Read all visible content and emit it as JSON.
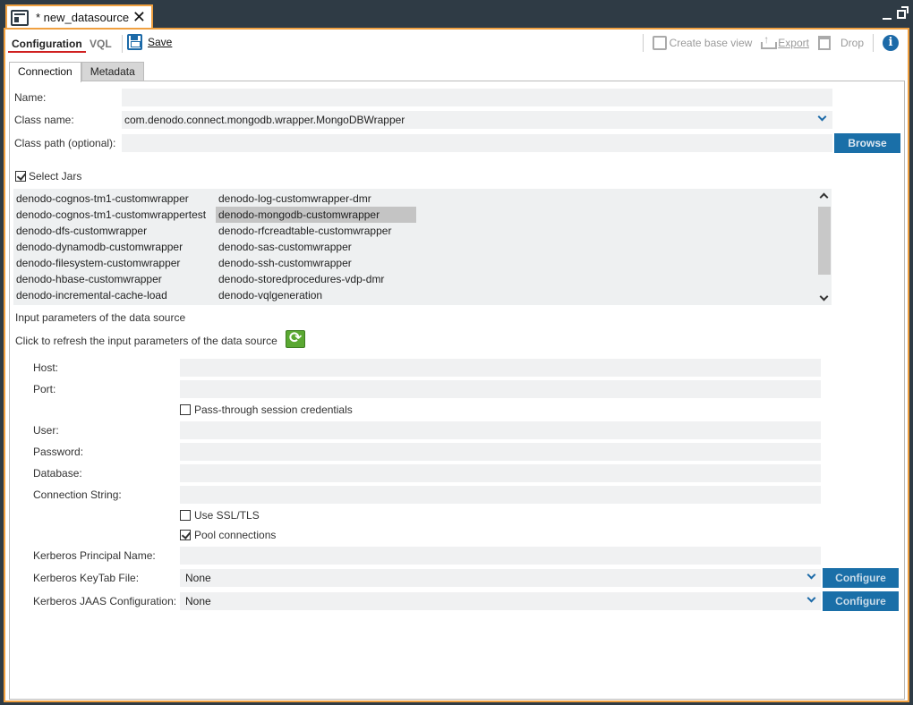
{
  "window": {
    "tab_title": "* new_datasource"
  },
  "toolbar": {
    "tab_configuration": "Configuration",
    "tab_vql": "VQL",
    "save_label": "Save",
    "create_base_view": "Create base view",
    "export": "Export",
    "drop": "Drop",
    "info": "i"
  },
  "tabs": {
    "connection": "Connection",
    "metadata": "Metadata"
  },
  "form": {
    "name_label": "Name:",
    "name_value": "",
    "class_name_label": "Class name:",
    "class_name_value": "com.denodo.connect.mongodb.wrapper.MongoDBWrapper",
    "class_path_label": "Class path (optional):",
    "class_path_value": "",
    "browse_button": "Browse",
    "select_jars_label": "Select Jars",
    "select_jars_checked": true
  },
  "jars": {
    "column1": [
      "denodo-cognos-tm1-customwrapper",
      "denodo-cognos-tm1-customwrappertest",
      "denodo-dfs-customwrapper",
      "denodo-dynamodb-customwrapper",
      "denodo-filesystem-customwrapper",
      "denodo-hbase-customwrapper",
      "denodo-incremental-cache-load"
    ],
    "column2": [
      "denodo-log-customwrapper-dmr",
      "denodo-mongodb-customwrapper",
      "denodo-rfcreadtable-customwrapper",
      "denodo-sas-customwrapper",
      "denodo-ssh-customwrapper",
      "denodo-storedprocedures-vdp-dmr",
      "denodo-vqlgeneration"
    ],
    "selected": "denodo-mongodb-customwrapper"
  },
  "params": {
    "section_title": "Input parameters of the data source",
    "refresh_text": "Click to refresh the input parameters of the data source",
    "host_label": "Host:",
    "port_label": "Port:",
    "passthrough_label": "Pass-through session credentials",
    "passthrough_checked": false,
    "user_label": "User:",
    "password_label": "Password:",
    "database_label": "Database:",
    "connection_string_label": "Connection String:",
    "ssl_label": "Use SSL/TLS",
    "ssl_checked": false,
    "pool_label": "Pool connections",
    "pool_checked": true,
    "kerberos_principal_label": "Kerberos Principal Name:",
    "kerberos_keytab_label": "Kerberos KeyTab File:",
    "kerberos_keytab_value": "None",
    "kerberos_jaas_label": "Kerberos JAAS Configuration:",
    "kerberos_jaas_value": "None",
    "configure_button": "Configure"
  },
  "colors": {
    "accent": "#1a6fa8",
    "frame_border": "#f0a040",
    "chrome": "#2f3b45",
    "field_bg": "#f0f1f2"
  }
}
